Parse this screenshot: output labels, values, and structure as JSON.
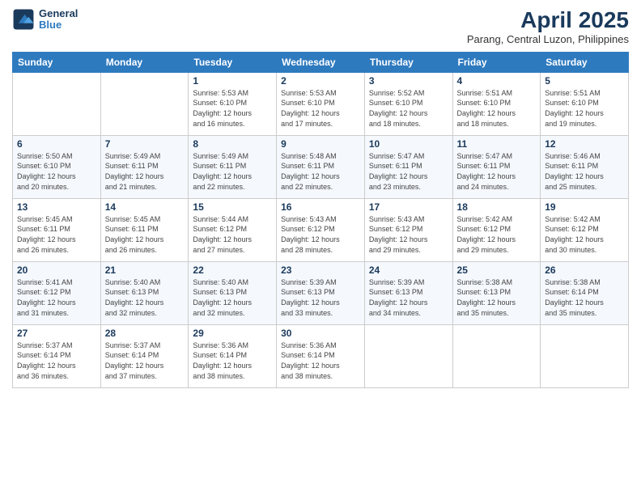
{
  "logo": {
    "line1": "General",
    "line2": "Blue"
  },
  "title": "April 2025",
  "subtitle": "Parang, Central Luzon, Philippines",
  "days_header": [
    "Sunday",
    "Monday",
    "Tuesday",
    "Wednesday",
    "Thursday",
    "Friday",
    "Saturday"
  ],
  "weeks": [
    [
      {
        "day": "",
        "detail": ""
      },
      {
        "day": "",
        "detail": ""
      },
      {
        "day": "1",
        "detail": "Sunrise: 5:53 AM\nSunset: 6:10 PM\nDaylight: 12 hours\nand 16 minutes."
      },
      {
        "day": "2",
        "detail": "Sunrise: 5:53 AM\nSunset: 6:10 PM\nDaylight: 12 hours\nand 17 minutes."
      },
      {
        "day": "3",
        "detail": "Sunrise: 5:52 AM\nSunset: 6:10 PM\nDaylight: 12 hours\nand 18 minutes."
      },
      {
        "day": "4",
        "detail": "Sunrise: 5:51 AM\nSunset: 6:10 PM\nDaylight: 12 hours\nand 18 minutes."
      },
      {
        "day": "5",
        "detail": "Sunrise: 5:51 AM\nSunset: 6:10 PM\nDaylight: 12 hours\nand 19 minutes."
      }
    ],
    [
      {
        "day": "6",
        "detail": "Sunrise: 5:50 AM\nSunset: 6:10 PM\nDaylight: 12 hours\nand 20 minutes."
      },
      {
        "day": "7",
        "detail": "Sunrise: 5:49 AM\nSunset: 6:11 PM\nDaylight: 12 hours\nand 21 minutes."
      },
      {
        "day": "8",
        "detail": "Sunrise: 5:49 AM\nSunset: 6:11 PM\nDaylight: 12 hours\nand 22 minutes."
      },
      {
        "day": "9",
        "detail": "Sunrise: 5:48 AM\nSunset: 6:11 PM\nDaylight: 12 hours\nand 22 minutes."
      },
      {
        "day": "10",
        "detail": "Sunrise: 5:47 AM\nSunset: 6:11 PM\nDaylight: 12 hours\nand 23 minutes."
      },
      {
        "day": "11",
        "detail": "Sunrise: 5:47 AM\nSunset: 6:11 PM\nDaylight: 12 hours\nand 24 minutes."
      },
      {
        "day": "12",
        "detail": "Sunrise: 5:46 AM\nSunset: 6:11 PM\nDaylight: 12 hours\nand 25 minutes."
      }
    ],
    [
      {
        "day": "13",
        "detail": "Sunrise: 5:45 AM\nSunset: 6:11 PM\nDaylight: 12 hours\nand 26 minutes."
      },
      {
        "day": "14",
        "detail": "Sunrise: 5:45 AM\nSunset: 6:11 PM\nDaylight: 12 hours\nand 26 minutes."
      },
      {
        "day": "15",
        "detail": "Sunrise: 5:44 AM\nSunset: 6:12 PM\nDaylight: 12 hours\nand 27 minutes."
      },
      {
        "day": "16",
        "detail": "Sunrise: 5:43 AM\nSunset: 6:12 PM\nDaylight: 12 hours\nand 28 minutes."
      },
      {
        "day": "17",
        "detail": "Sunrise: 5:43 AM\nSunset: 6:12 PM\nDaylight: 12 hours\nand 29 minutes."
      },
      {
        "day": "18",
        "detail": "Sunrise: 5:42 AM\nSunset: 6:12 PM\nDaylight: 12 hours\nand 29 minutes."
      },
      {
        "day": "19",
        "detail": "Sunrise: 5:42 AM\nSunset: 6:12 PM\nDaylight: 12 hours\nand 30 minutes."
      }
    ],
    [
      {
        "day": "20",
        "detail": "Sunrise: 5:41 AM\nSunset: 6:12 PM\nDaylight: 12 hours\nand 31 minutes."
      },
      {
        "day": "21",
        "detail": "Sunrise: 5:40 AM\nSunset: 6:13 PM\nDaylight: 12 hours\nand 32 minutes."
      },
      {
        "day": "22",
        "detail": "Sunrise: 5:40 AM\nSunset: 6:13 PM\nDaylight: 12 hours\nand 32 minutes."
      },
      {
        "day": "23",
        "detail": "Sunrise: 5:39 AM\nSunset: 6:13 PM\nDaylight: 12 hours\nand 33 minutes."
      },
      {
        "day": "24",
        "detail": "Sunrise: 5:39 AM\nSunset: 6:13 PM\nDaylight: 12 hours\nand 34 minutes."
      },
      {
        "day": "25",
        "detail": "Sunrise: 5:38 AM\nSunset: 6:13 PM\nDaylight: 12 hours\nand 35 minutes."
      },
      {
        "day": "26",
        "detail": "Sunrise: 5:38 AM\nSunset: 6:14 PM\nDaylight: 12 hours\nand 35 minutes."
      }
    ],
    [
      {
        "day": "27",
        "detail": "Sunrise: 5:37 AM\nSunset: 6:14 PM\nDaylight: 12 hours\nand 36 minutes."
      },
      {
        "day": "28",
        "detail": "Sunrise: 5:37 AM\nSunset: 6:14 PM\nDaylight: 12 hours\nand 37 minutes."
      },
      {
        "day": "29",
        "detail": "Sunrise: 5:36 AM\nSunset: 6:14 PM\nDaylight: 12 hours\nand 38 minutes."
      },
      {
        "day": "30",
        "detail": "Sunrise: 5:36 AM\nSunset: 6:14 PM\nDaylight: 12 hours\nand 38 minutes."
      },
      {
        "day": "",
        "detail": ""
      },
      {
        "day": "",
        "detail": ""
      },
      {
        "day": "",
        "detail": ""
      }
    ]
  ]
}
